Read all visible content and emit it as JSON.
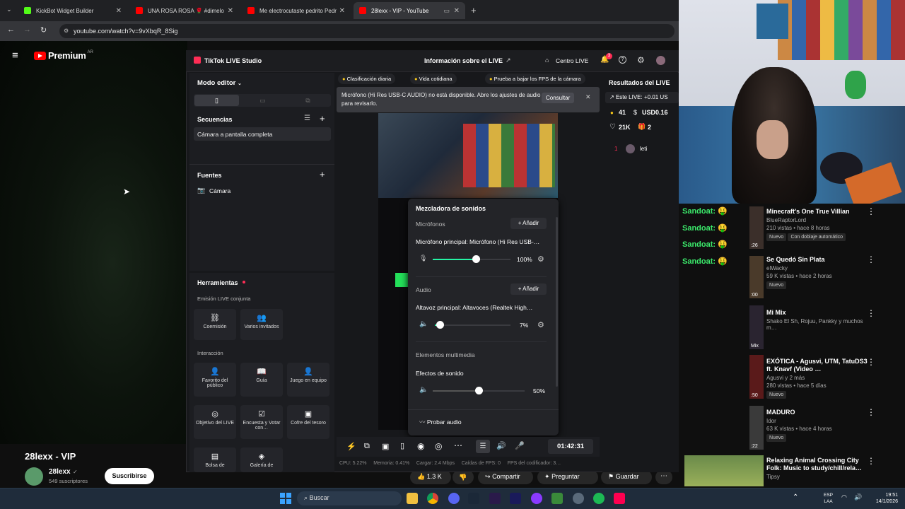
{
  "browser": {
    "tabs": [
      {
        "label": "KickBot Widget Builder",
        "color": "#53fc18"
      },
      {
        "label": "UNA ROSA ROSA 🌹 #dimelo",
        "color": "#ff0000"
      },
      {
        "label": "Me electrocutaste pedrito Pedr",
        "color": "#ff0000"
      },
      {
        "label": "28lexx - VIP - YouTube",
        "color": "#ff0000"
      }
    ],
    "url": "youtube.com/watch?v=9vXbqR_8Sig"
  },
  "youtube": {
    "logo": "Premium",
    "region": "AR",
    "video_title": "28lexx - VIP",
    "channel": "28lexx",
    "subscribers": "549 suscriptores",
    "subscribe": "Suscribirse",
    "likes": "1.3 K",
    "share": "Compartir",
    "ask": "Preguntar",
    "save": "Guardar",
    "recommendations": [
      {
        "title": "Minecraft's One True Villian",
        "channel": "BlueRaptorLord",
        "meta": "210 vistas • hace 8 horas",
        "badge": "Nuevo",
        "badge2": "Con doblaje automático",
        "time": ":26"
      },
      {
        "title": "Se Quedó Sin Plata",
        "channel": "elWacky",
        "meta": "59 K vistas • hace 2 horas",
        "badge": "Nuevo",
        "time": ":00"
      },
      {
        "title": "Mi Mix",
        "channel": "Shako El Sh, Rojuu, Pankky y muchos m…",
        "meta": "",
        "badge": "",
        "time": "Mix"
      },
      {
        "title": "EXÓTICA - Agusvi, UTM, TatuDS3 ft. Knavf (Video …",
        "channel": "Agusvi y 2 más",
        "meta": "280 vistas • hace 5 días",
        "badge": "Nuevo",
        "time": ":50"
      },
      {
        "title": "MADURO",
        "channel": "Idor",
        "meta": "63 K vistas • hace 4 horas",
        "badge": "Nuevo",
        "time": ":22"
      },
      {
        "title": "Relaxing Animal Crossing City Folk: Music to study/chill/rela…",
        "channel": "Tipsy",
        "meta": "",
        "badge": "",
        "time": ""
      }
    ]
  },
  "chat": [
    "Sandoat:",
    "Sandoat:",
    "Sandoat:",
    "Sandoat:"
  ],
  "tiktok": {
    "app": "TikTok LIVE Studio",
    "header_center": "Información sobre el LIVE",
    "centro": "Centro LIVE",
    "notif_count": "3",
    "editor_mode": "Modo editor",
    "sequences": "Secuencias",
    "sequence_item": "Cámara a pantalla completa",
    "sources": "Fuentes",
    "source_item": "Cámara",
    "tools": "Herramientas",
    "joint": "Emisión LIVE conjunta",
    "interaction": "Interacción",
    "tool_items": [
      "Coemisión",
      "Varios invitados",
      "Favorito del público",
      "Guía",
      "Juego en equipo",
      "Objetivo del LIVE",
      "Encuesta y Votar con…",
      "Cofre del tesoro",
      "Bolsa de",
      "Galería de"
    ],
    "chips": [
      "Clasificación diaria",
      "Vida cotidiana",
      "Prueba a bajar los FPS de la cámara"
    ],
    "banner": "Micrófono (Hi Res USB-C AUDIO) no está disponible. Abre los ajustes de audio para revisarlo.",
    "banner_btn": "Consultar",
    "mixer": {
      "title": "Mezcladora de sonidos",
      "mics": "Micrófonos",
      "add": "+ Añadir",
      "mic_main": "Micrófono principal: Micrófono (Hi Res USB-…",
      "mic_vol": "100%",
      "mic_level": 1.0,
      "audio": "Audio",
      "speaker_main": "Altavoz principal: Altavoces (Realtek High…",
      "speaker_vol": "7%",
      "speaker_level": 0.07,
      "media": "Elementos multimedia",
      "effects": "Efectos de sonido",
      "effects_vol": "50%",
      "effects_level": 0.5,
      "test": "Probar audio"
    },
    "timer": "01:42:31",
    "stats": "CPU: 5.22%     Memoria: 0.41%     Cargar: 2.4 Mbps     Caídas de FPS: 0     FPS del codificador: 3…",
    "results": {
      "title": "Resultados del LIVE",
      "earn": "Este LIVE: +0.01 US",
      "coins": "41",
      "usd": "USD0.16",
      "likes": "21K",
      "gifts": "2",
      "rank": "1",
      "viewer": "leti"
    }
  },
  "taskbar": {
    "search": "Buscar",
    "lang1": "ESP",
    "lang2": "LAA",
    "time": "19:51",
    "date": "14/1/2026"
  }
}
